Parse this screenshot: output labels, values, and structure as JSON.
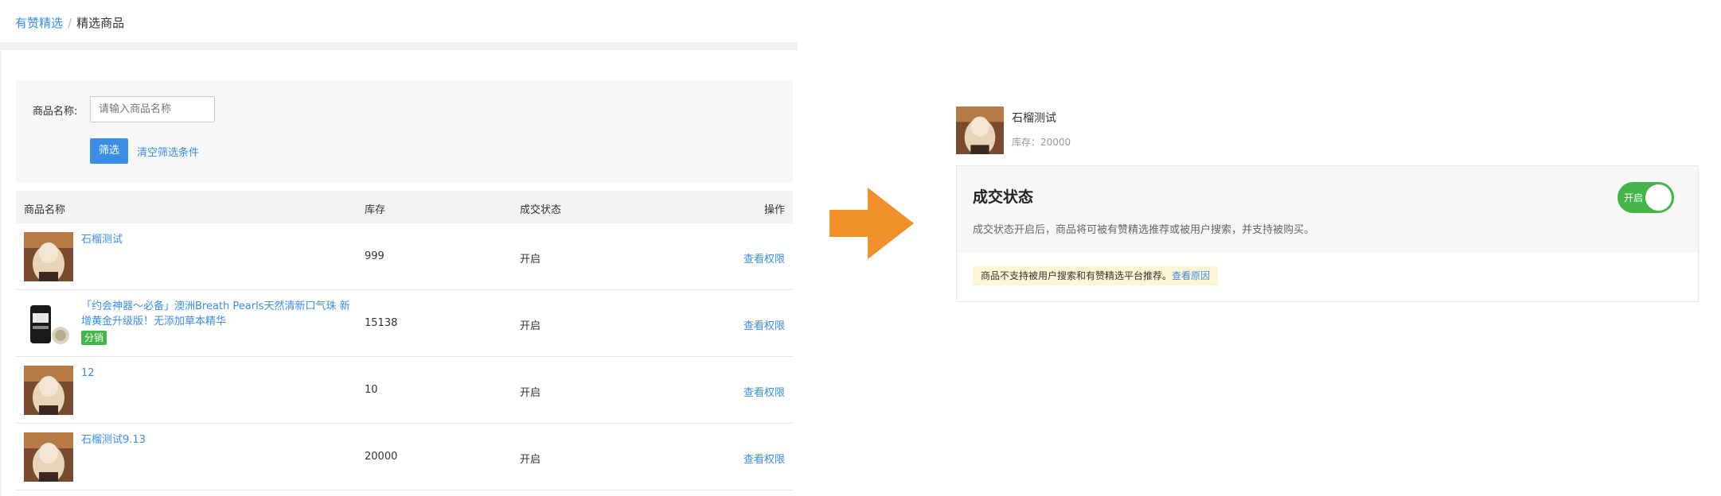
{
  "breadcrumb": {
    "root": "有赞精选",
    "sep": "/",
    "current": "精选商品"
  },
  "filter": {
    "name_label": "商品名称:",
    "name_placeholder": "请输入商品名称",
    "submit_label": "筛选",
    "clear_label": "清空筛选条件"
  },
  "table": {
    "headers": {
      "name": "商品名称",
      "stock": "库存",
      "status": "成交状态",
      "op": "操作"
    },
    "rows": [
      {
        "name": "石榴测试",
        "tag": "",
        "stock": "999",
        "status": "开启",
        "op": "查看权限",
        "thumb": "anime-girl"
      },
      {
        "name": "「约会神器～必备」澳洲Breath Pearls天然清新口气珠 新增黄金升级版！无添加草本精华",
        "tag": "分销",
        "stock": "15138",
        "status": "开启",
        "op": "查看权限",
        "thumb": "bottle"
      },
      {
        "name": "12",
        "tag": "",
        "stock": "10",
        "status": "开启",
        "op": "查看权限",
        "thumb": "anime-girl"
      },
      {
        "name": "石榴测试9.13",
        "tag": "",
        "stock": "20000",
        "status": "开启",
        "op": "查看权限",
        "thumb": "anime-girl"
      }
    ]
  },
  "detail": {
    "title": "石榴测试",
    "stock_line": "库存：20000",
    "status_heading": "成交状态",
    "status_desc": "成交状态开启后，商品将可被有赞精选推荐或被用户搜索，并支持被购买。",
    "toggle_label": "开启",
    "toggle_on": true,
    "notice_text": "商品不支持被用户搜索和有赞精选平台推荐。",
    "notice_link": "查看原因"
  },
  "colors": {
    "accent": "#3a8ee6",
    "success": "#44b549",
    "arrow": "#f0902a"
  },
  "icons": {
    "arrow": "right-arrow-icon"
  }
}
